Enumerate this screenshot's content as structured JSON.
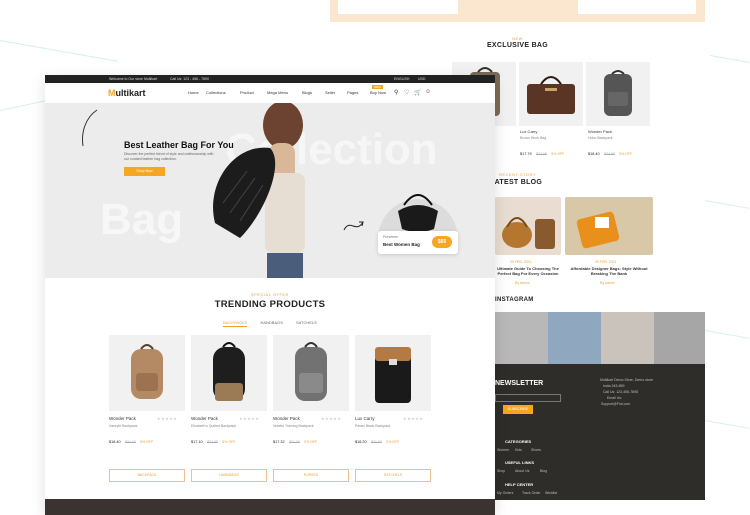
{
  "back_page": {
    "exclusive": {
      "kicker": "NEW",
      "title": "EXCLUSIVE BAG"
    },
    "bags": [
      {
        "name": "",
        "price": ""
      },
      {
        "name": "Lux Carry",
        "desc": "Brown Work Bag",
        "price": "$17.79",
        "old": "$22.99",
        "off": "5% OFF"
      },
      {
        "name": "",
        "price": ""
      },
      {
        "name": "Wonder Pack",
        "desc": "Hobo Backpack",
        "price": "$18.40",
        "old": "$24.88",
        "off": "5% OFF"
      }
    ],
    "blog": {
      "kicker": "RECENT STORY",
      "title": "LATEST BLOG",
      "posts": [
        {
          "date": "25 FEB, 2021",
          "title": "Ultimate Guide To Choosing The Perfect Bag For Every Occasion",
          "link": "By Admin"
        },
        {
          "date": "25 FEB, 2021",
          "title": "Affordable Designer Bags: Style Without Breaking The Bank",
          "link": "By Admin"
        }
      ]
    },
    "instagram": {
      "title": "INSTAGRAM"
    },
    "newsletter": {
      "title": "NEWSLETTER",
      "button": "SUBSCRIBE",
      "contact": [
        "Multikart Demo Store, Demo store",
        "India 345-659",
        "Call Us: 123-456-7898",
        "Email Us:",
        "Support@Fiot.com"
      ],
      "categories_title": "CATEGORIES",
      "categories": [
        "Women",
        "Kids",
        "Shoes"
      ],
      "links_title": "USEFUL LINKS",
      "links": [
        "Shop",
        "About Us",
        "Blog"
      ],
      "help_title": "HELP CENTER",
      "help": [
        "My Orders",
        "Track Order",
        "Wishlist"
      ]
    }
  },
  "front_page": {
    "topbar": {
      "welcome": "Welcome to Our store Multikart",
      "phone": "Call Us: 123 - 456 - 7890",
      "language": "ENGLISH",
      "currency": "USD"
    },
    "logo": {
      "first": "M",
      "rest": "ultikart"
    },
    "nav": [
      "Home",
      "Collections",
      "Product",
      "Mega Menu",
      "Blogs",
      "Seller",
      "Pages",
      "Buy Now"
    ],
    "nav_badge": "NEW",
    "hero": {
      "title": "Best Leather Bag For You",
      "desc": "Discover the perfect blend of style and craftsmanship with our curated leather bag collection.",
      "button": "Shop Now",
      "watermark_1": "Collection",
      "watermark_2": "Bag"
    },
    "popup": {
      "kicker": "Purseeee",
      "name": "Best Women Bag",
      "price": "$65"
    },
    "trending": {
      "kicker": "SPECIAL OFFER",
      "title": "TRENDING PRODUCTS",
      "tabs": [
        "BACKPACKS",
        "HANDBAGS",
        "SATCHELS"
      ]
    },
    "products": [
      {
        "name": "Wonder Pack",
        "desc": "Vaseyle Backpack",
        "price": "$18.40",
        "old": "$24.00",
        "off": "5% OFF"
      },
      {
        "name": "Wonder Pack",
        "desc": "Elizabeth's Quilted Backpack",
        "price": "$17.10",
        "old": "$22.90",
        "off": "5% OFF"
      },
      {
        "name": "Wonder Pack",
        "desc": "Noteful Training Backpack",
        "price": "$17.32",
        "old": "$21.00",
        "off": "5% OFF"
      },
      {
        "name": "Lux Carry",
        "desc": "Pastel Black Backpack",
        "price": "$16.20",
        "old": "$21.00",
        "off": "5% OFF"
      }
    ],
    "categories": [
      "BACKPACK",
      "HANDBAGS",
      "PURSES",
      "SATCHELS"
    ]
  },
  "colors": {
    "accent": "#f5a623",
    "dark": "#222222",
    "card": "#f1f1f1"
  }
}
